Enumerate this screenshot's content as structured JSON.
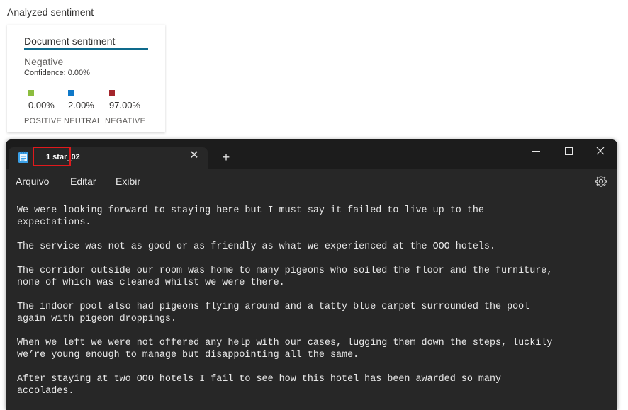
{
  "sentiment_panel": {
    "title": "Analyzed sentiment",
    "card_title": "Document sentiment",
    "label": "Negative",
    "confidence": "Confidence: 0.00%",
    "stats": [
      {
        "percent": "0.00%",
        "name": "POSITIVE",
        "color": "#8cbd3f"
      },
      {
        "percent": "2.00%",
        "name": "NEUTRAL",
        "color": "#0f78c8"
      },
      {
        "percent": "97.00%",
        "name": "NEGATIVE",
        "color": "#a4262c"
      }
    ]
  },
  "notepad": {
    "app_icon": "notepad-icon",
    "tab_title": "1 star_02",
    "tab_close_icon": "close-icon",
    "new_tab_icon": "plus-icon",
    "window_controls": [
      "minimize-icon",
      "maximize-icon",
      "close-icon"
    ],
    "menu": [
      "Arquivo",
      "Editar",
      "Exibir"
    ],
    "settings_icon": "gear-icon",
    "highlight_color": "#e0191c",
    "paragraphs": [
      "We were looking forward to staying here but I must say it failed to live up to the\nexpectations.",
      "The service was not as good or as friendly as what we experienced at the OOO hotels.",
      "The corridor outside our room was home to many pigeons who soiled the floor and the furniture,\nnone of which was cleaned whilst we were there.",
      "The indoor pool also had pigeons flying around and a tatty blue carpet surrounded the pool\nagain with pigeon droppings.",
      "When we left we were not offered any help with our cases, lugging them down the steps, luckily\nwe’re young enough to manage but disappointing all the same.",
      "After staying at two OOO hotels I fail to see how this hotel has been awarded so many\naccolades."
    ]
  }
}
